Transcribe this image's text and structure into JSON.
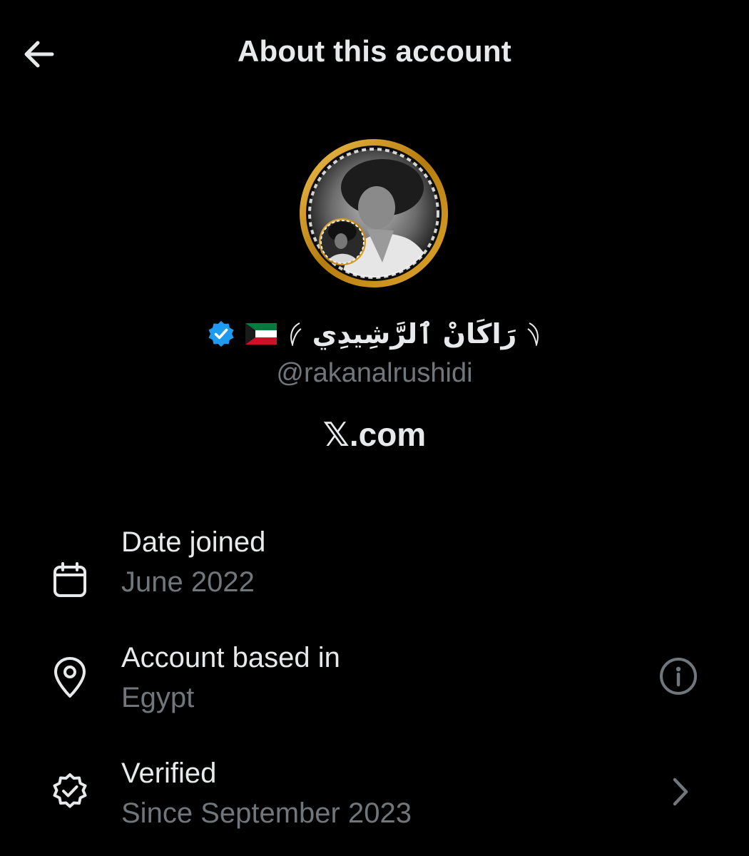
{
  "header": {
    "title": "About this account",
    "back_icon": "arrow-left-icon"
  },
  "profile": {
    "display_name": "رَاكَانْ ٱلرَّشِيدِي",
    "flag": "kuwait-flag-icon",
    "verified_badge": "verified-badge-icon",
    "handle": "@rakanalrushidi",
    "site": "𝕏.com"
  },
  "rows": [
    {
      "icon": "calendar-icon",
      "title": "Date joined",
      "value": "June 2022"
    },
    {
      "icon": "location-pin-icon",
      "title": "Account based in",
      "value": "Egypt",
      "trailing_icon": "info-icon"
    },
    {
      "icon": "verified-outline-icon",
      "title": "Verified",
      "value": "Since September 2023",
      "trailing_icon": "chevron-right-icon"
    }
  ],
  "colors": {
    "background": "#000000",
    "primary_text": "#e7e9ea",
    "secondary_text": "#71767b",
    "verified_blue": "#1d9bf0",
    "avatar_ring": "#d4a017"
  }
}
